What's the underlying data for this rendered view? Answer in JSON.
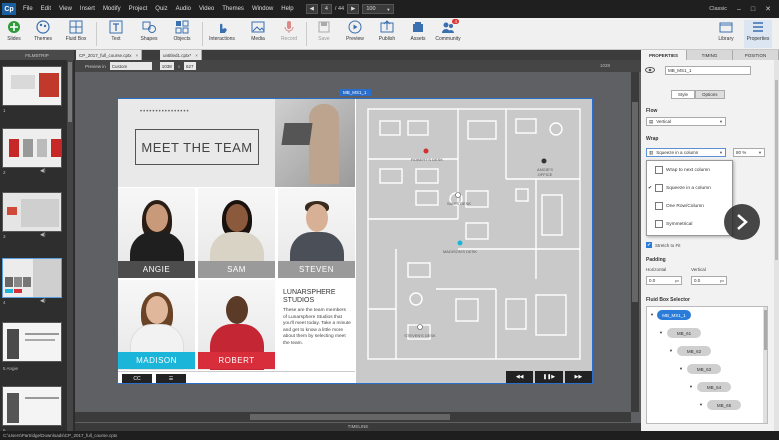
{
  "app": {
    "logo": "Cp",
    "menu": [
      "File",
      "Edit",
      "View",
      "Insert",
      "Modify",
      "Project",
      "Quiz",
      "Audio",
      "Video",
      "Themes",
      "Window",
      "Help"
    ],
    "slide_current": "4",
    "slide_total": "/ 44",
    "zoom": "100",
    "workspace": "Classic",
    "window_controls": [
      "–",
      "□",
      "✕"
    ]
  },
  "toolbar": {
    "left": [
      {
        "label": "Slides",
        "icon": "plus-circle-icon"
      },
      {
        "label": "Themes",
        "icon": "themes-icon"
      },
      {
        "label": "Fluid Box",
        "icon": "fluid-box-icon"
      },
      {
        "label": "Text",
        "icon": "text-icon"
      },
      {
        "label": "Shapes",
        "icon": "shapes-icon"
      },
      {
        "label": "Objects",
        "icon": "objects-icon"
      },
      {
        "label": "Interactions",
        "icon": "interactions-icon"
      },
      {
        "label": "Media",
        "icon": "media-icon"
      },
      {
        "label": "Record",
        "icon": "record-icon"
      },
      {
        "label": "Save",
        "icon": "save-icon"
      },
      {
        "label": "Preview",
        "icon": "preview-icon"
      },
      {
        "label": "Publish",
        "icon": "publish-icon"
      },
      {
        "label": "Assets",
        "icon": "assets-icon"
      },
      {
        "label": "Community",
        "icon": "community-icon",
        "badge": "4"
      }
    ],
    "right": [
      {
        "label": "Library",
        "icon": "library-icon"
      },
      {
        "label": "Properties",
        "icon": "properties-icon"
      }
    ]
  },
  "tabs": {
    "filmstrip": "FILMSTRIP",
    "docs": [
      "CP_2017_full_course.cptx",
      "untitled1.cptx*"
    ],
    "panel": [
      "PROPERTIES",
      "TIMING",
      "POSITION"
    ],
    "panel_active": 0
  },
  "filmstrip": {
    "slides": [
      {
        "num": "1",
        "audio": false
      },
      {
        "num": "2",
        "audio": true
      },
      {
        "num": "3",
        "audio": true
      },
      {
        "num": "4",
        "audio": true
      },
      {
        "num": "5",
        "audio": false
      },
      {
        "num": "6",
        "audio": false
      }
    ],
    "slide5_caption": "5 Angie"
  },
  "stage": {
    "preview_label": "Preview in",
    "preview_mode": "Custom",
    "width": "1038",
    "x": "x",
    "height": "627",
    "ruler_right": "1038",
    "fluid_box_label": "MB_MS1_1"
  },
  "slide": {
    "dots": "••••••••••••••••",
    "title": "MEET THE TEAM",
    "people": [
      {
        "name": "ANGIE",
        "bar_color": "#4d4d4d"
      },
      {
        "name": "SAM",
        "bar_color": "#9a9a9a"
      },
      {
        "name": "STEVEN",
        "bar_color": "#9a9a9a"
      },
      {
        "name": "MADISON",
        "bar_color": "#1ab5d9"
      },
      {
        "name": "ROBERT",
        "bar_color": "#d82d3a"
      }
    ],
    "bio_title": "LUNARSPHERE STUDIOS",
    "bio_text": "These are the team members of Lunarsphere Studios that you'll meet today. Take a minute and get to know a little more about them by selecting meet the team.",
    "controls": {
      "cc": "CC",
      "menu": "☰"
    },
    "nav": [
      "◀◀",
      "❚❚▶",
      "▶▶"
    ],
    "map_labels": [
      "ROBERT'S DESK",
      "ANGIE'S OFFICE",
      "SAM'S DESK",
      "MADISON'S DESK",
      "STEVEN'S DESK"
    ]
  },
  "bottom": {
    "timeline": "TIMELINE",
    "status_path": "C:\\Users\\Partridge\\Downloads\\CP_2017_full_course.cptx"
  },
  "props": {
    "object_name": "MB_MS1_1",
    "tabs": [
      "Style",
      "Options"
    ],
    "flow_label": "Flow",
    "flow_value": "Vertical",
    "wrap_label": "Wrap",
    "wrap_value": "Squeeze in a column",
    "wrap_percent": "80 %",
    "wrap_options": [
      {
        "label": "Wrap to next column",
        "checked": false
      },
      {
        "label": "Squeeze in a column",
        "checked": true
      },
      {
        "label": "One Row/Column",
        "checked": false
      },
      {
        "label": "Symmetrical",
        "checked": false
      }
    ],
    "stretch_label": "Stretch to Fit",
    "padding_label": "Padding",
    "padding_h_label": "Horizontal",
    "padding_v_label": "Vertical",
    "padding_h": "0.0",
    "padding_v": "0.0",
    "px": "px",
    "selector_label": "Fluid Box Selector",
    "tree": [
      "MB_MS1_1",
      "MB_61",
      "MB_62",
      "MB_63",
      "MB_64",
      "MB_65"
    ]
  }
}
